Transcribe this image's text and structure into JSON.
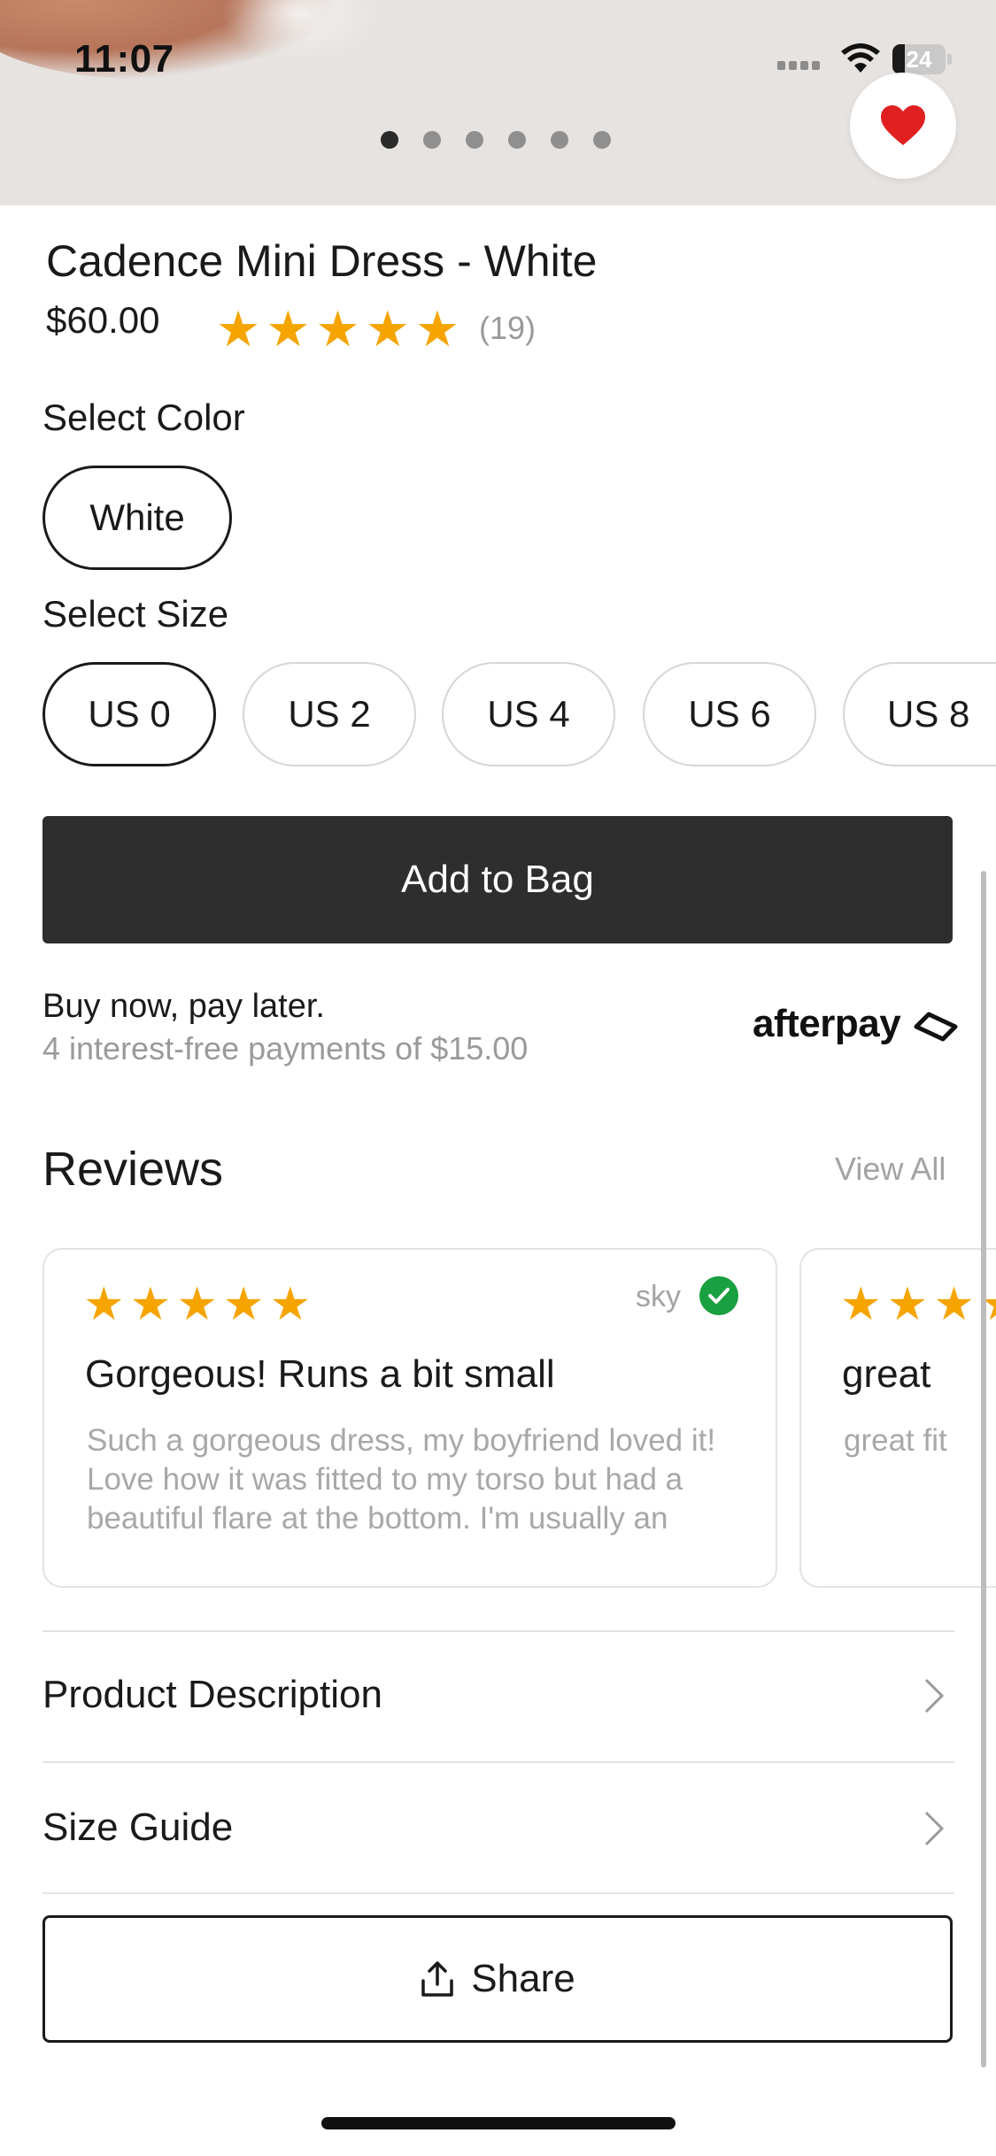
{
  "status_bar": {
    "time": "11:07",
    "battery": "24",
    "battery_level": 0.24
  },
  "gallery": {
    "image_count": 6,
    "active_index": 0
  },
  "product": {
    "title": "Cadence Mini Dress - White",
    "price": "$60.00",
    "rating": 5,
    "review_count": "(19)"
  },
  "color": {
    "label": "Select Color",
    "options": [
      "White"
    ],
    "selected": "White"
  },
  "size": {
    "label": "Select Size",
    "options": [
      "US 0",
      "US 2",
      "US 4",
      "US 6",
      "US 8"
    ],
    "selected": "US 0"
  },
  "actions": {
    "add_to_bag": "Add to Bag",
    "share": "Share"
  },
  "afterpay": {
    "title": "Buy now, pay later.",
    "subtitle": "4 interest-free payments of $15.00",
    "logo_text": "afterpay"
  },
  "reviews": {
    "title": "Reviews",
    "view_all": "View All",
    "items": [
      {
        "rating": 5,
        "reviewer": "sky",
        "title": "Gorgeous! Runs a bit small",
        "body": "Such a gorgeous dress, my boyfriend loved it! Love how it was fitted to my torso but had a beautiful flare at the bottom. I'm usually an"
      },
      {
        "rating": 5,
        "reviewer": "",
        "title": "great",
        "body": "great fit"
      }
    ]
  },
  "sections": [
    {
      "label": "Product Description"
    },
    {
      "label": "Size Guide"
    }
  ],
  "colors": {
    "star": "#f5a400",
    "heart": "#e02020",
    "verified": "#19a040",
    "primary_button": "#2e2e2e"
  },
  "icons": [
    "heart-icon",
    "wifi-icon",
    "battery-icon",
    "star-icon",
    "verified-check-icon",
    "chevron-right-icon",
    "share-icon"
  ]
}
